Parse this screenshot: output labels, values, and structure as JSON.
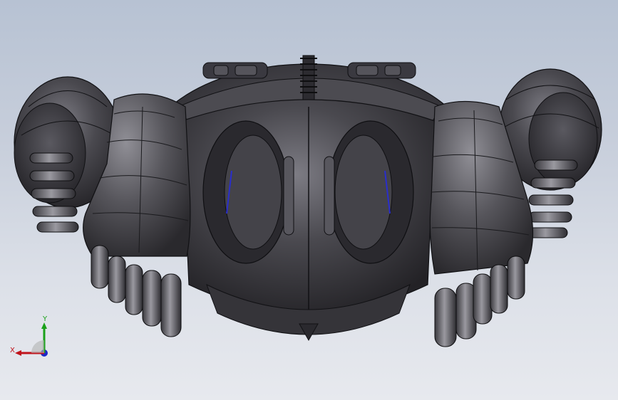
{
  "viewport": {
    "background_top": "#b7c2d3",
    "background_bottom": "#e7e9ee"
  },
  "model": {
    "body_color": "#3e3d42",
    "highlight_color": "#8a8990",
    "edge_color": "#111114",
    "accent_color": "#2a2ecc"
  },
  "triad": {
    "x_label": "X",
    "y_label": "Y",
    "x_color": "#c0141c",
    "y_color": "#1aa11a",
    "z_color": "#1b27c8"
  }
}
